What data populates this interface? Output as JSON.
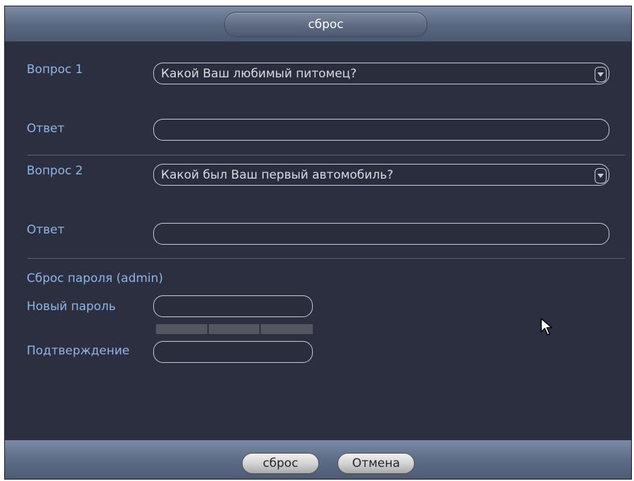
{
  "header": {
    "title": "сброс"
  },
  "question1": {
    "label": "Вопрос 1",
    "selected": "Какой Ваш любимый питомец?",
    "answer_label": "Ответ",
    "answer_value": ""
  },
  "question2": {
    "label": "Вопрос 2",
    "selected": "Какой был Ваш первый автомобиль?",
    "answer_label": "Ответ",
    "answer_value": ""
  },
  "password": {
    "section_title": "Сброс пароля (admin)",
    "new_label": "Новый пароль",
    "new_value": "",
    "confirm_label": "Подтверждение",
    "confirm_value": ""
  },
  "footer": {
    "reset_label": "сброс",
    "cancel_label": "Отмена"
  },
  "icons": {
    "dropdown": "chevron-down-icon",
    "cursor": "mouse-pointer-icon"
  },
  "colors": {
    "background": "#2c2f3f",
    "label": "#8fb5e6",
    "bar": "#6a7a95"
  }
}
